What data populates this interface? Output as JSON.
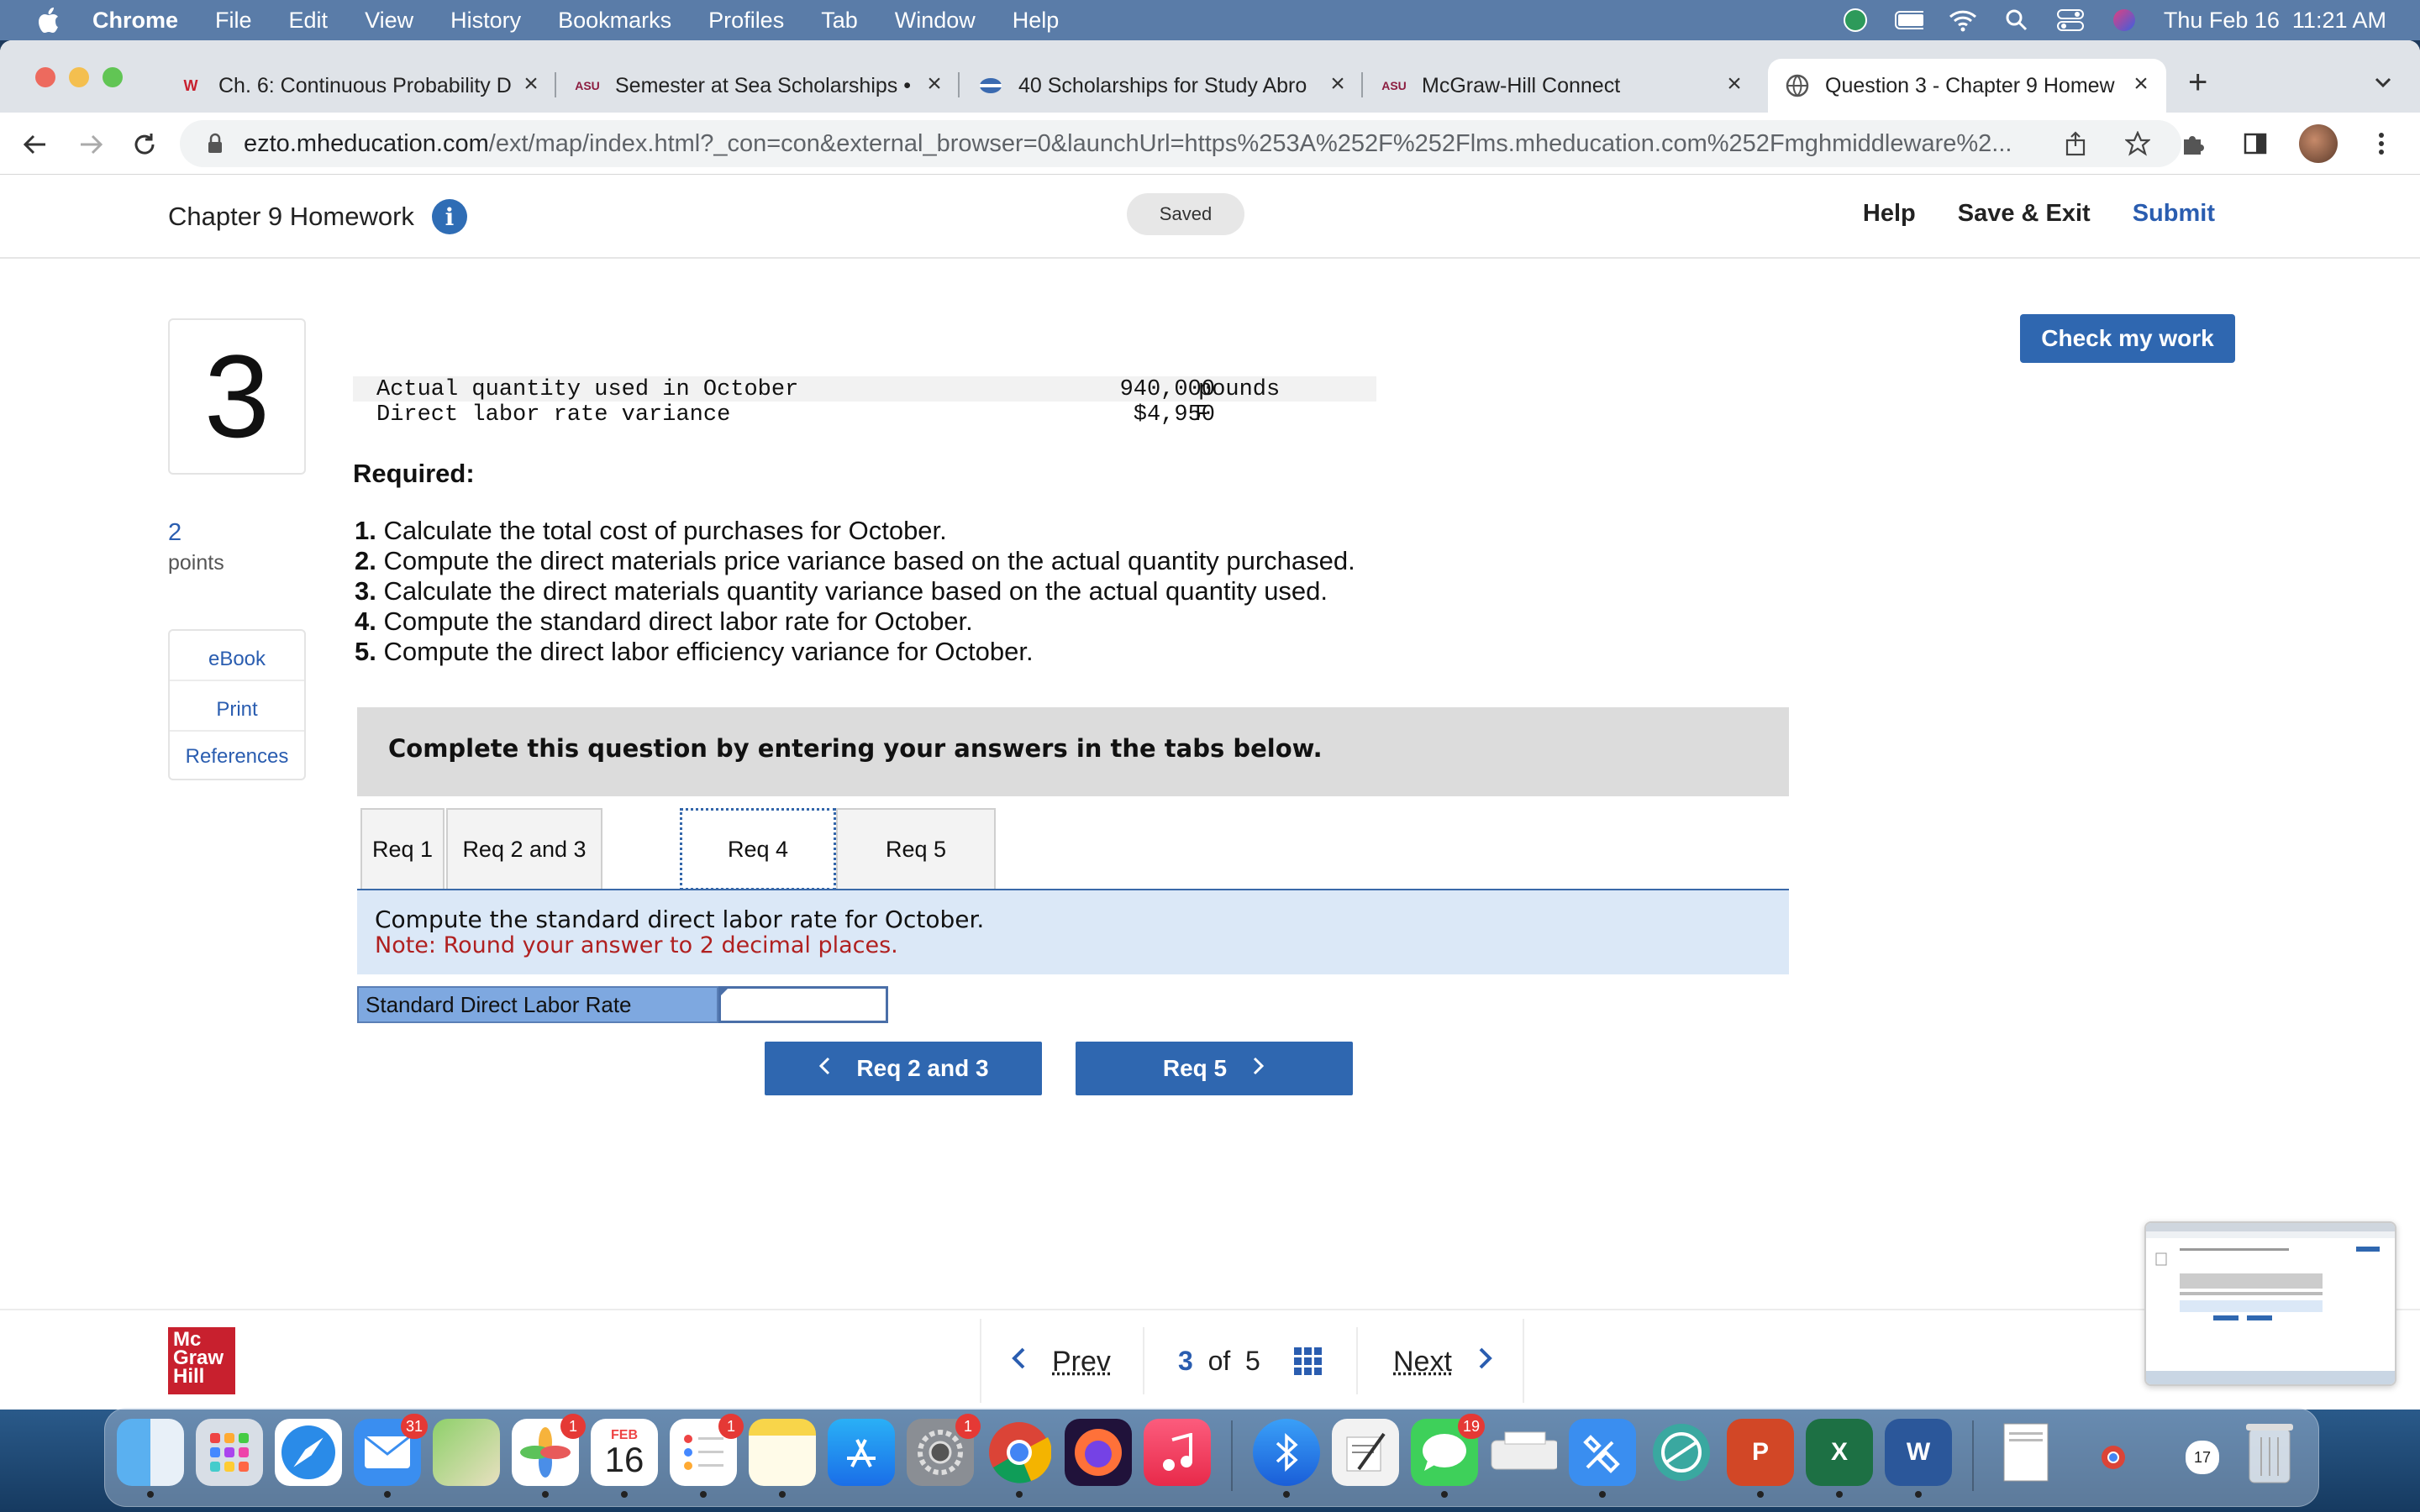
{
  "menubar": {
    "app": "Chrome",
    "items": [
      "File",
      "Edit",
      "View",
      "History",
      "Bookmarks",
      "Profiles",
      "Tab",
      "Window",
      "Help"
    ],
    "datetime": "Thu Feb 16  11:21 AM"
  },
  "browser": {
    "tabs": [
      {
        "title": "Ch. 6: Continuous Probability D",
        "favicon": "W"
      },
      {
        "title": "Semester at Sea Scholarships •",
        "favicon": "ASU"
      },
      {
        "title": "40 Scholarships for Study Abro",
        "favicon": "globe"
      },
      {
        "title": "McGraw-Hill Connect",
        "favicon": "ASU"
      },
      {
        "title": "Question 3 - Chapter 9 Homew",
        "favicon": "globe"
      }
    ],
    "url_host": "ezto.mheducation.com",
    "url_path": "/ext/map/index.html?_con=con&external_browser=0&launchUrl=https%253A%252F%252Flms.mheducation.com%252Fmghmiddleware%2..."
  },
  "header": {
    "title": "Chapter 9 Homework",
    "saved": "Saved",
    "help": "Help",
    "save_exit": "Save & Exit",
    "submit": "Submit"
  },
  "question": {
    "number": "3",
    "points_value": "2",
    "points_label": "points",
    "side_links": [
      "eBook",
      "Print",
      "References"
    ],
    "check_label": "Check my work",
    "data_rows": [
      {
        "label": "Actual quantity used in October",
        "value": "940,000",
        "unit": "pounds"
      },
      {
        "label": "Direct labor rate variance",
        "value": "$4,950",
        "unit": "F"
      }
    ],
    "required_label": "Required:",
    "requirements": [
      {
        "num": "1.",
        "text": " Calculate the total cost of purchases for October."
      },
      {
        "num": "2.",
        "text": " Compute the direct materials price variance based on the actual quantity purchased."
      },
      {
        "num": "3.",
        "text": " Calculate the direct materials quantity variance based on the actual quantity used."
      },
      {
        "num": "4.",
        "text": " Compute the standard direct labor rate for October."
      },
      {
        "num": "5.",
        "text": " Compute the direct labor efficiency variance for October."
      }
    ],
    "complete_text": "Complete this question by entering your answers in the tabs below.",
    "req_tabs": [
      "Req 1",
      "Req 2 and 3",
      "Req 4",
      "Req 5"
    ],
    "active_tab": "Req 4",
    "instruction": "Compute the standard direct labor rate for October.",
    "note": "Note: Round your answer to 2 decimal places.",
    "answer_label": "Standard Direct Labor Rate",
    "answer_value": "",
    "prev_req": "Req 2 and 3",
    "next_req": "Req 5"
  },
  "footer": {
    "logo": [
      "Mc",
      "Graw",
      "Hill"
    ],
    "prev": "Prev",
    "current": "3",
    "of": "of",
    "total": "5",
    "next": "Next"
  },
  "dock": {
    "calendar_month": "FEB",
    "calendar_day": "16",
    "badges": {
      "mail": "31",
      "photos": "1",
      "reminders": "1",
      "settings": "1",
      "messages": "19"
    },
    "mini_calendar_day": "17"
  },
  "colors": {
    "accent": "#2f67b0",
    "note_red": "#b02020",
    "answer_label_bg": "#7ea8e0",
    "instruction_bg": "#dbe8f7"
  }
}
